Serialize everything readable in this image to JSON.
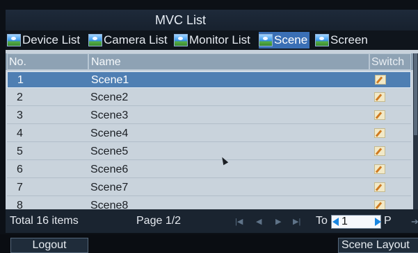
{
  "window": {
    "title": "MVC List"
  },
  "tabs": [
    {
      "label": "Device List",
      "icon": "image-icon",
      "active": false
    },
    {
      "label": "Camera List",
      "icon": "image-icon",
      "active": false
    },
    {
      "label": "Monitor List",
      "icon": "image-icon",
      "active": false
    },
    {
      "label": "Scene",
      "icon": "image-icon",
      "active": true
    },
    {
      "label": "Screen",
      "icon": "image-icon",
      "active": false
    }
  ],
  "table": {
    "columns": [
      "No.",
      "Name",
      "Switch"
    ],
    "rows": [
      {
        "no": "1",
        "name": "Scene1",
        "selected": true
      },
      {
        "no": "2",
        "name": "Scene2",
        "selected": false
      },
      {
        "no": "3",
        "name": "Scene3",
        "selected": false
      },
      {
        "no": "4",
        "name": "Scene4",
        "selected": false
      },
      {
        "no": "5",
        "name": "Scene5",
        "selected": false
      },
      {
        "no": "6",
        "name": "Scene6",
        "selected": false
      },
      {
        "no": "7",
        "name": "Scene7",
        "selected": false
      },
      {
        "no": "8",
        "name": "Scene8",
        "selected": false
      }
    ],
    "switch_icon": "edit-icon"
  },
  "footer": {
    "total": "Total 16 items",
    "page": "Page 1/2",
    "nav_icons": [
      "first-page-icon",
      "prev-page-icon",
      "next-page-icon",
      "last-page-icon"
    ],
    "to_label": "To",
    "page_input_value": "1",
    "page_suffix": "P",
    "go_icon": "go-arrow-icon"
  },
  "buttons": {
    "logout": "Logout",
    "scene_layout": "Scene Layout"
  },
  "colors": {
    "accent": "#3a6fb5",
    "selected_row": "#4f7fb3",
    "table_bg": "#c8d2dc",
    "header_bg": "#8ea2b4",
    "arrow": "#1a86e0"
  }
}
